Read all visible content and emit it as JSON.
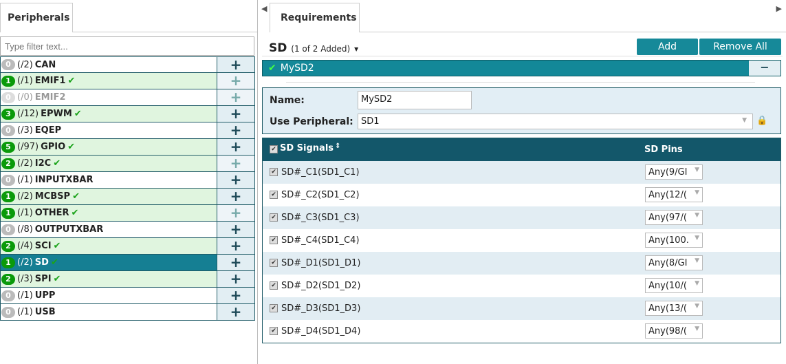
{
  "left": {
    "tab": "Peripherals",
    "filter_placeholder": "Type filter text...",
    "items": [
      {
        "count": "0",
        "total": "(/2)",
        "name": "CAN",
        "state": "none"
      },
      {
        "count": "1",
        "total": "(/1)",
        "name": "EMIF1",
        "state": "ok",
        "plus": "light"
      },
      {
        "count": "0",
        "total": "(/0)",
        "name": "EMIF2",
        "state": "dis",
        "plus": "light"
      },
      {
        "count": "3",
        "total": "(/12)",
        "name": "EPWM",
        "state": "ok"
      },
      {
        "count": "0",
        "total": "(/3)",
        "name": "EQEP",
        "state": "none"
      },
      {
        "count": "5",
        "total": "(/97)",
        "name": "GPIO",
        "state": "ok"
      },
      {
        "count": "2",
        "total": "(/2)",
        "name": "I2C",
        "state": "ok",
        "plus": "light"
      },
      {
        "count": "0",
        "total": "(/1)",
        "name": "INPUTXBAR",
        "state": "none"
      },
      {
        "count": "1",
        "total": "(/2)",
        "name": "MCBSP",
        "state": "ok"
      },
      {
        "count": "1",
        "total": "(/1)",
        "name": "OTHER",
        "state": "ok",
        "plus": "light"
      },
      {
        "count": "0",
        "total": "(/8)",
        "name": "OUTPUTXBAR",
        "state": "none"
      },
      {
        "count": "2",
        "total": "(/4)",
        "name": "SCI",
        "state": "ok"
      },
      {
        "count": "1",
        "total": "(/2)",
        "name": "SD",
        "state": "sel"
      },
      {
        "count": "2",
        "total": "(/3)",
        "name": "SPI",
        "state": "ok"
      },
      {
        "count": "0",
        "total": "(/1)",
        "name": "UPP",
        "state": "none"
      },
      {
        "count": "0",
        "total": "(/1)",
        "name": "USB",
        "state": "none"
      }
    ]
  },
  "right": {
    "tab": "Requirements",
    "title": "SD",
    "subtitle": "(1 of 2 Added)",
    "add": "Add",
    "remove_all": "Remove All",
    "instance": "MySD2",
    "minus": "−",
    "name_label": "Name:",
    "name_value": "MySD2",
    "periph_label": "Use Peripheral:",
    "periph_value": "SD1",
    "col_signals": "SD Signals",
    "col_pins": "SD Pins",
    "rows": [
      {
        "signal": "SD#_C1(SD1_C1)",
        "pin": "Any(9/GI"
      },
      {
        "signal": "SD#_C2(SD1_C2)",
        "pin": "Any(12/("
      },
      {
        "signal": "SD#_C3(SD1_C3)",
        "pin": "Any(97/("
      },
      {
        "signal": "SD#_C4(SD1_C4)",
        "pin": "Any(100."
      },
      {
        "signal": "SD#_D1(SD1_D1)",
        "pin": "Any(8/GI"
      },
      {
        "signal": "SD#_D2(SD1_D2)",
        "pin": "Any(10/("
      },
      {
        "signal": "SD#_D3(SD1_D3)",
        "pin": "Any(13/("
      },
      {
        "signal": "SD#_D4(SD1_D4)",
        "pin": "Any(98/("
      }
    ]
  }
}
